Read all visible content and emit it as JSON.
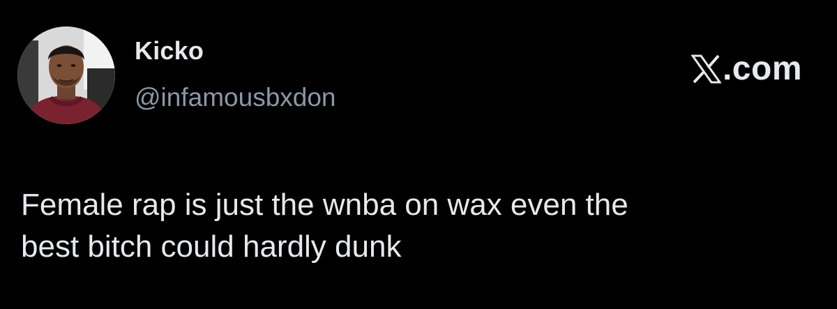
{
  "author": {
    "display_name": "Kicko",
    "handle": "@infamousbxdon"
  },
  "brand": {
    "logo_icon": "x-logo-icon",
    "suffix": ".com"
  },
  "tweet": {
    "text": "Female rap is just the wnba on wax even the\nbest bitch could hardly dunk"
  },
  "colors": {
    "background": "#000000",
    "primary_text": "#e7e9ea",
    "secondary_text": "#8b98a5"
  }
}
